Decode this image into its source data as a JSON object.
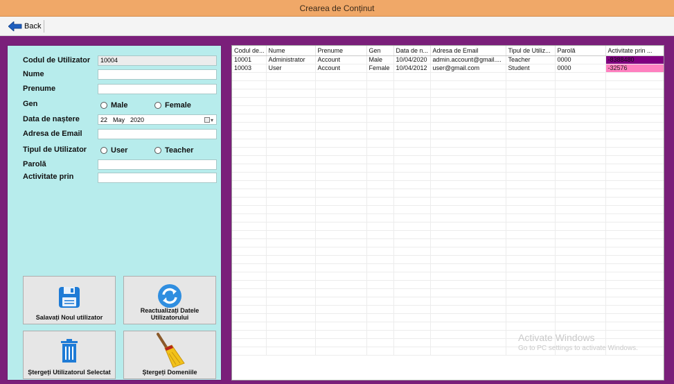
{
  "window": {
    "title": "Crearea de Conținut"
  },
  "toolbar": {
    "back_label": "Back"
  },
  "form": {
    "user_code_label": "Codul de Utilizator",
    "user_code_value": "10004",
    "name_label": "Nume",
    "surname_label": "Prenume",
    "gender_label": "Gen",
    "gender_male": "Male",
    "gender_female": "Female",
    "birth_label": "Data de naștere",
    "birth_day": "22",
    "birth_month": "May",
    "birth_year": "2020",
    "email_label": "Adresa de Email",
    "user_type_label": "Tipul de Utilizator",
    "type_user": "User",
    "type_teacher": "Teacher",
    "password_label": "Parolă",
    "activity_label": "Activitate prin"
  },
  "buttons": {
    "save": "Salavați Noul utilizator",
    "refresh": "Reactualizați Datele Utilizatorului",
    "delete": "Ștergeți Utilizatorul Selectat",
    "clear": "Ștergeți Domeniile"
  },
  "grid": {
    "columns": [
      "Codul de...",
      "Nume",
      "Prenume",
      "Gen",
      "Data de n...",
      "Adresa de Email",
      "Tipul de Utiliz...",
      "Parolă",
      "Activitate prin ..."
    ],
    "rows": [
      {
        "cells": [
          "10001",
          "Administrator",
          "Account",
          "Male",
          "10/04/2020",
          "admin.account@gmail....",
          "Teacher",
          "0000",
          "-8388480"
        ],
        "color": "#800080"
      },
      {
        "cells": [
          "10003",
          "User",
          "Account",
          "Female",
          "10/04/2012",
          "user@gmail.com",
          "Student",
          "0000",
          "-32576"
        ],
        "color": "#ff80c0"
      }
    ]
  },
  "watermark": {
    "title": "Activate Windows",
    "subtitle": "Go to PC settings to activate Windows."
  }
}
